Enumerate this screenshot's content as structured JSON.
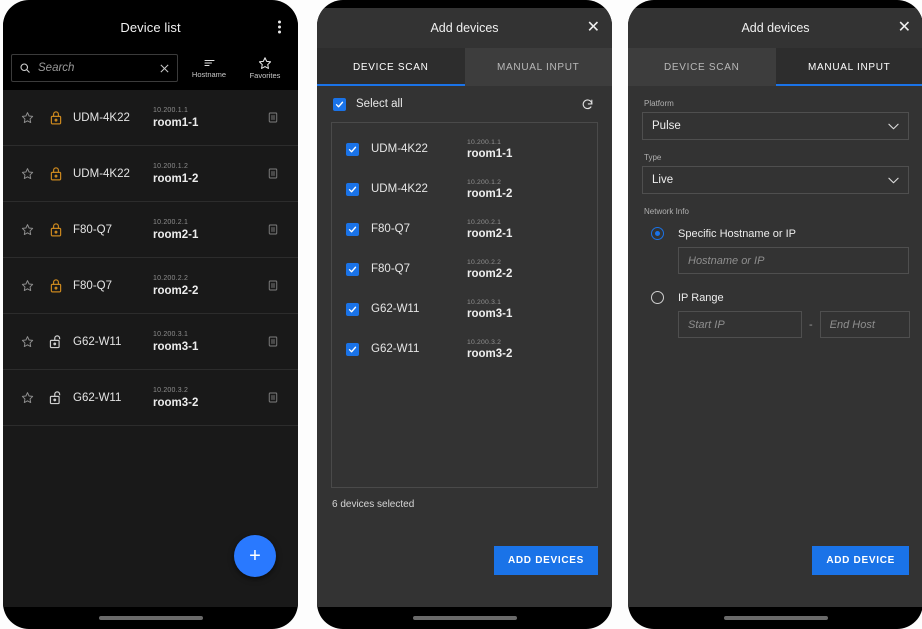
{
  "colors": {
    "accent_blue": "#1a73e8",
    "fab_blue": "#2979ff",
    "lock_amber": "#c8861e",
    "panel_bg": "#333333",
    "list_bg": "#191919"
  },
  "panel1": {
    "title": "Device list",
    "menu_icon": "kebab-menu-icon",
    "search": {
      "icon": "search-icon",
      "placeholder": "Search",
      "clear_icon": "clear-x-icon"
    },
    "sort_button": {
      "label": "Hostname",
      "icon": "sort-icon"
    },
    "favorites_button": {
      "label": "Favorites",
      "icon": "star-icon"
    },
    "rows": [
      {
        "hostname": "UDM-4K22",
        "ip": "10.200.1.1",
        "room": "room1-1",
        "locked": true,
        "favorite": false
      },
      {
        "hostname": "UDM-4K22",
        "ip": "10.200.1.2",
        "room": "room1-2",
        "locked": true,
        "favorite": false
      },
      {
        "hostname": "F80-Q7",
        "ip": "10.200.2.1",
        "room": "room2-1",
        "locked": true,
        "favorite": false
      },
      {
        "hostname": "F80-Q7",
        "ip": "10.200.2.2",
        "room": "room2-2",
        "locked": true,
        "favorite": false
      },
      {
        "hostname": "G62-W11",
        "ip": "10.200.3.1",
        "room": "room3-1",
        "locked": false,
        "favorite": false
      },
      {
        "hostname": "G62-W11",
        "ip": "10.200.3.2",
        "room": "room3-2",
        "locked": false,
        "favorite": false
      }
    ],
    "fab": {
      "label": "+",
      "icon": "plus-icon"
    }
  },
  "panel2": {
    "title": "Add devices",
    "close_icon": "close-x-icon",
    "tabs": [
      {
        "label": "DEVICE SCAN",
        "active": true
      },
      {
        "label": "MANUAL INPUT",
        "active": false
      }
    ],
    "select_all": {
      "label": "Select all",
      "checked": true
    },
    "refresh_icon": "refresh-icon",
    "scan_rows": [
      {
        "name": "UDM-4K22",
        "ip": "10.200.1.1",
        "room": "room1-1",
        "checked": true
      },
      {
        "name": "UDM-4K22",
        "ip": "10.200.1.2",
        "room": "room1-2",
        "checked": true
      },
      {
        "name": "F80-Q7",
        "ip": "10.200.2.1",
        "room": "room2-1",
        "checked": true
      },
      {
        "name": "F80-Q7",
        "ip": "10.200.2.2",
        "room": "room2-2",
        "checked": true
      },
      {
        "name": "G62-W11",
        "ip": "10.200.3.1",
        "room": "room3-1",
        "checked": true
      },
      {
        "name": "G62-W11",
        "ip": "10.200.3.2",
        "room": "room3-2",
        "checked": true
      }
    ],
    "selected_count_text": "6 devices selected",
    "primary_button": "ADD DEVICES"
  },
  "panel3": {
    "title": "Add devices",
    "close_icon": "close-x-icon",
    "tabs": [
      {
        "label": "DEVICE SCAN",
        "active": false
      },
      {
        "label": "MANUAL INPUT",
        "active": true
      }
    ],
    "platform": {
      "label": "Platform",
      "value": "Pulse"
    },
    "type": {
      "label": "Type",
      "value": "Live"
    },
    "network_info": {
      "label": "Network Info",
      "option_specific": {
        "label": "Specific Hostname or IP",
        "selected": true
      },
      "hostname_placeholder": "Hostname or IP",
      "option_range": {
        "label": "IP Range",
        "selected": false
      },
      "start_ip_placeholder": "Start IP",
      "range_separator": "-",
      "end_host_placeholder": "End Host"
    },
    "primary_button": "ADD DEVICE"
  }
}
